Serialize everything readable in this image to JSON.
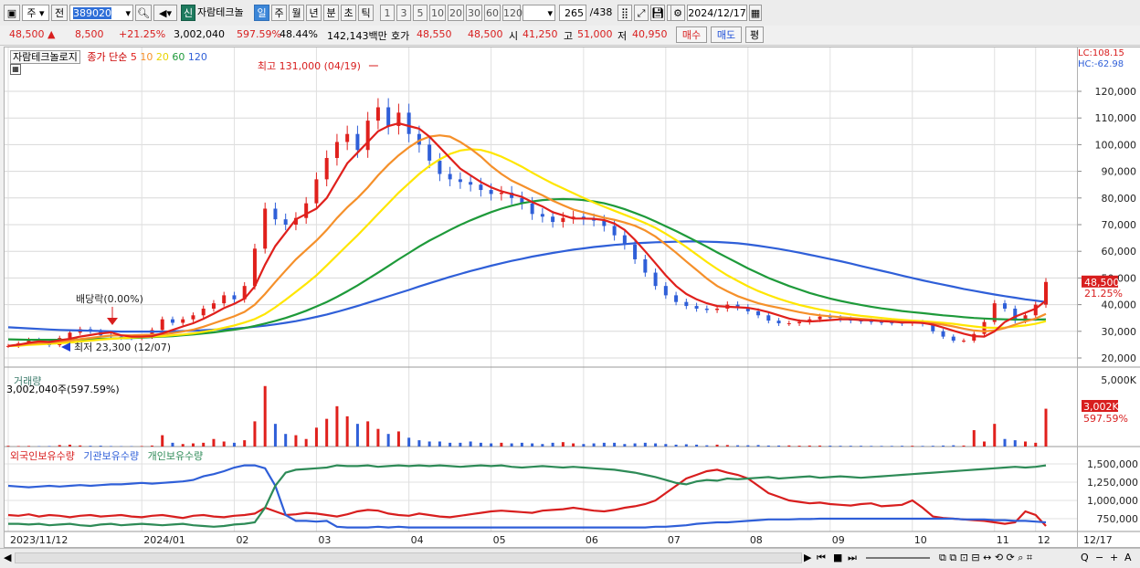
{
  "toolbar": {
    "market": "주",
    "prev_label": "전",
    "code": "389020",
    "new_badge": "신",
    "stock_name": "자람테크놀",
    "periods": [
      "일",
      "주",
      "월",
      "년",
      "분",
      "초",
      "틱"
    ],
    "active_period": "일",
    "intervals": [
      "1",
      "3",
      "5",
      "10",
      "20",
      "30",
      "60",
      "120"
    ],
    "count": "265",
    "total": "/438",
    "date": "2024/12/17"
  },
  "quote": {
    "price": "48,500 ▲",
    "change": "8,500",
    "change_pct": "+21.25%",
    "volume": "3,002,040",
    "volume_ratio": "597.59%",
    "turnover": "48.44%",
    "amount": "142,143백만",
    "bid_label": "호가",
    "ask": "48,550",
    "bid": "48,500",
    "open_label": "시",
    "open": "41,250",
    "high_label": "고",
    "high": "51,000",
    "low_label": "저",
    "low": "40,950",
    "buy_label": "매수",
    "sell_label": "매도",
    "avg_label": "평"
  },
  "chart_data": {
    "type": "candlestick",
    "title": "자람테크놀로지",
    "legend": {
      "ma_label": "종가 단순",
      "periods": [
        "5",
        "10",
        "20",
        "60",
        "120"
      ],
      "colors": [
        "#e0201c",
        "#f5902a",
        "#ffe600",
        "#1e9a3a",
        "#2f5fd8"
      ]
    },
    "price_axis": {
      "ticks": [
        "120,000",
        "110,000",
        "100,000",
        "90,000",
        "80,000",
        "70,000",
        "60,000",
        "50,000",
        "40,000",
        "30,000",
        "20,000"
      ],
      "min": 20000,
      "max": 120000
    },
    "lc": "LC:108.15",
    "hc": "HC:-62.98",
    "last_price": "48,500",
    "last_pct": "21.25%",
    "annotation_high": "최고 131,000 (04/19)",
    "annotation_low": "최저 23,300 (12/07)",
    "annotation_dividend": "배당락(0.00%)",
    "x_labels": [
      "2023/11/12",
      "2024/01",
      "02",
      "03",
      "04",
      "05",
      "06",
      "07",
      "08",
      "09",
      "10",
      "11",
      "12"
    ],
    "axis_end_date": "12/17",
    "closes": [
      24500,
      25500,
      26800,
      26000,
      24800,
      27500,
      29500,
      30800,
      30000,
      28500,
      28000,
      27600,
      27500,
      28000,
      30500,
      34500,
      33200,
      34500,
      36000,
      38500,
      40500,
      43500,
      42000,
      47000,
      61000,
      76000,
      72000,
      70000,
      72500,
      78000,
      87000,
      95000,
      101000,
      104000,
      98000,
      109000,
      114000,
      107000,
      112000,
      104000,
      100000,
      94000,
      89000,
      87000,
      86000,
      85000,
      83000,
      81500,
      82000,
      80000,
      78000,
      74000,
      73000,
      71000,
      72500,
      73000,
      72000,
      71500,
      69500,
      66000,
      62500,
      57000,
      52000,
      47000,
      43500,
      41000,
      39500,
      38500,
      38000,
      38500,
      40000,
      39000,
      37500,
      36000,
      34000,
      33000,
      33000,
      33500,
      34500,
      35500,
      35000,
      34500,
      34000,
      33800,
      33500,
      33300,
      33200,
      33000,
      33300,
      32800,
      30000,
      28000,
      26500,
      26500,
      29000,
      33500,
      40500,
      38500,
      34000,
      36000,
      40000,
      48500
    ],
    "ma5": [
      24500,
      25000,
      25700,
      26200,
      26000,
      26600,
      27200,
      28000,
      28600,
      29200,
      29600,
      28500,
      28000,
      28000,
      28200,
      29200,
      30500,
      31800,
      33000,
      34700,
      36600,
      38700,
      40300,
      42300,
      46800,
      55000,
      62000,
      67000,
      72000,
      74000,
      76000,
      80000,
      86500,
      93000,
      97000,
      101000,
      105000,
      107000,
      108000,
      107000,
      106000,
      103000,
      99000,
      95000,
      91000,
      88500,
      86000,
      84000,
      82500,
      81500,
      80400,
      78500,
      76800,
      74700,
      73500,
      72300,
      72300,
      72200,
      71700,
      70400,
      68000,
      64300,
      60000,
      55500,
      51000,
      47000,
      44000,
      42000,
      40500,
      39500,
      39200,
      39000,
      38800,
      38100,
      37200,
      36000,
      34800,
      34000,
      33700,
      33900,
      34200,
      34500,
      34500,
      34200,
      34100,
      33800,
      33600,
      33300,
      33300,
      33100,
      32500,
      31400,
      30200,
      29100,
      28200,
      28000,
      30000,
      33500,
      35500,
      37000,
      38500,
      41500
    ],
    "ma10": [
      24500,
      24800,
      25300,
      25600,
      25800,
      26100,
      26500,
      27100,
      27500,
      28000,
      28400,
      28500,
      28500,
      28600,
      28700,
      28900,
      29300,
      29900,
      30600,
      31700,
      33000,
      34300,
      35600,
      37300,
      40000,
      44000,
      48500,
      52800,
      57000,
      60500,
      64000,
      68000,
      72500,
      76500,
      80000,
      84000,
      88500,
      92500,
      96000,
      99000,
      101500,
      103000,
      103500,
      103000,
      101000,
      98500,
      95500,
      92000,
      89000,
      86500,
      84700,
      82800,
      81000,
      79000,
      77300,
      75700,
      74600,
      73600,
      72600,
      71800,
      70800,
      69600,
      67800,
      65500,
      62600,
      59500,
      56200,
      53000,
      49800,
      47000,
      45000,
      43200,
      41800,
      40500,
      39600,
      38800,
      38000,
      37200,
      36500,
      36000,
      35600,
      35300,
      35000,
      34700,
      34400,
      34100,
      33900,
      33700,
      33500,
      33300,
      33000,
      32500,
      31800,
      31000,
      30300,
      30000,
      30300,
      31200,
      32500,
      33700,
      34800,
      36500
    ],
    "ma20": [
      24500,
      24600,
      24900,
      25100,
      25300,
      25500,
      25800,
      26200,
      26500,
      26900,
      27200,
      27400,
      27600,
      27800,
      28000,
      28200,
      28500,
      28800,
      29200,
      29800,
      30500,
      31300,
      32200,
      33300,
      34600,
      36500,
      39000,
      41800,
      44800,
      47800,
      51000,
      54700,
      58500,
      62300,
      66000,
      70000,
      74000,
      78000,
      82000,
      85500,
      89000,
      92000,
      94500,
      96500,
      97800,
      98300,
      98000,
      97000,
      95500,
      93700,
      91700,
      89500,
      87400,
      85400,
      83600,
      81800,
      80000,
      78300,
      76700,
      75200,
      73700,
      72200,
      70600,
      68800,
      66600,
      64200,
      61600,
      58800,
      56000,
      53400,
      51000,
      48900,
      46900,
      45100,
      43600,
      42200,
      41000,
      39900,
      39000,
      38200,
      37500,
      36900,
      36300,
      35800,
      35400,
      35000,
      34600,
      34300,
      34000,
      33800,
      33500,
      33200,
      32800,
      32300,
      31800,
      31400,
      31300,
      31400,
      31800,
      32200,
      32800,
      33800
    ],
    "ma60": [
      27000,
      26900,
      26800,
      26800,
      26800,
      26800,
      26900,
      27000,
      27100,
      27200,
      27300,
      27400,
      27500,
      27600,
      27800,
      28000,
      28200,
      28500,
      28800,
      29200,
      29600,
      30100,
      30600,
      31200,
      32000,
      32900,
      33900,
      35000,
      36300,
      37700,
      39300,
      41000,
      42900,
      45000,
      47200,
      49600,
      52000,
      54500,
      57000,
      59400,
      61800,
      64000,
      66000,
      68000,
      69900,
      71600,
      73200,
      74700,
      76000,
      77100,
      78000,
      78700,
      79200,
      79500,
      79600,
      79500,
      79200,
      78700,
      78000,
      77000,
      75800,
      74400,
      72900,
      71200,
      69400,
      67600,
      65700,
      63700,
      61700,
      59600,
      57600,
      55600,
      53600,
      51800,
      50000,
      48500,
      47000,
      45700,
      44400,
      43300,
      42300,
      41400,
      40600,
      39900,
      39200,
      38600,
      38100,
      37600,
      37200,
      36800,
      36400,
      36000,
      35700,
      35300,
      35000,
      34800,
      34600,
      34500,
      34400,
      34400,
      34400,
      34500
    ],
    "ma120": [
      31500,
      31300,
      31100,
      30900,
      30700,
      30500,
      30400,
      30300,
      30200,
      30100,
      30000,
      29900,
      29900,
      29900,
      29900,
      29900,
      30000,
      30100,
      30200,
      30400,
      30600,
      30800,
      31000,
      31300,
      31700,
      32100,
      32600,
      33200,
      33800,
      34600,
      35400,
      36300,
      37300,
      38400,
      39500,
      40700,
      41900,
      43100,
      44300,
      45500,
      46800,
      48000,
      49200,
      50400,
      51500,
      52600,
      53600,
      54600,
      55500,
      56400,
      57200,
      58000,
      58700,
      59400,
      60000,
      60600,
      61100,
      61600,
      62000,
      62400,
      62700,
      63000,
      63200,
      63400,
      63500,
      63600,
      63700,
      63700,
      63600,
      63500,
      63300,
      63000,
      62600,
      62100,
      61500,
      60900,
      60200,
      59500,
      58700,
      57900,
      57100,
      56300,
      55400,
      54500,
      53600,
      52700,
      51800,
      50900,
      50000,
      49100,
      48300,
      47500,
      46700,
      45900,
      45200,
      44500,
      43800,
      43200,
      42600,
      42000,
      41500,
      41000
    ],
    "volume_panel": {
      "title": "거래량",
      "current": "3,002,040주(597.59%)",
      "ticks": [
        "5,000K"
      ],
      "last_value": "3,002K",
      "last_pct": "597.59%",
      "values": [
        60,
        40,
        50,
        30,
        40,
        120,
        150,
        90,
        60,
        70,
        40,
        30,
        30,
        40,
        80,
        900,
        300,
        200,
        250,
        300,
        600,
        400,
        300,
        500,
        2000,
        4800,
        1800,
        1000,
        900,
        600,
        1500,
        2200,
        3200,
        2400,
        1800,
        2000,
        1400,
        1000,
        1200,
        700,
        500,
        400,
        400,
        300,
        300,
        400,
        300,
        250,
        300,
        250,
        300,
        250,
        200,
        300,
        350,
        250,
        200,
        250,
        300,
        300,
        200,
        250,
        300,
        250,
        200,
        150,
        180,
        150,
        100,
        150,
        120,
        100,
        100,
        120,
        80,
        80,
        90,
        70,
        80,
        80,
        70,
        60,
        60,
        60,
        50,
        50,
        50,
        60,
        60,
        50,
        60,
        80,
        100,
        80,
        1300,
        400,
        1800,
        600,
        500,
        400,
        300,
        3002
      ]
    },
    "holdings_panel": {
      "legend": [
        "외국인보유수량",
        "기관보유수량",
        "개인보유수량"
      ],
      "colors": [
        "#d81e1e",
        "#2f5fd8",
        "#2e8b57"
      ],
      "ticks": [
        "1,500,000",
        "1,250,000",
        "1,000,000",
        "750,000"
      ],
      "min": 600000,
      "max": 1600000,
      "foreign": [
        800000,
        790000,
        810000,
        780000,
        800000,
        790000,
        770000,
        790000,
        800000,
        780000,
        790000,
        800000,
        780000,
        770000,
        790000,
        800000,
        780000,
        760000,
        790000,
        800000,
        780000,
        770000,
        790000,
        800000,
        820000,
        900000,
        850000,
        800000,
        810000,
        830000,
        820000,
        800000,
        780000,
        810000,
        850000,
        870000,
        860000,
        820000,
        800000,
        790000,
        820000,
        800000,
        780000,
        770000,
        790000,
        810000,
        830000,
        850000,
        860000,
        850000,
        840000,
        830000,
        860000,
        870000,
        880000,
        900000,
        880000,
        860000,
        850000,
        870000,
        900000,
        920000,
        950000,
        1000000,
        1100000,
        1200000,
        1300000,
        1350000,
        1400000,
        1420000,
        1380000,
        1350000,
        1300000,
        1200000,
        1100000,
        1050000,
        1000000,
        980000,
        960000,
        970000,
        950000,
        940000,
        930000,
        950000,
        960000,
        920000,
        930000,
        940000,
        1000000,
        900000,
        780000,
        760000,
        750000,
        740000,
        730000,
        720000,
        700000,
        680000,
        700000,
        850000,
        800000,
        650000
      ],
      "institution": [
        1200000,
        1190000,
        1180000,
        1190000,
        1200000,
        1190000,
        1200000,
        1210000,
        1200000,
        1210000,
        1220000,
        1220000,
        1230000,
        1240000,
        1230000,
        1240000,
        1250000,
        1260000,
        1280000,
        1330000,
        1360000,
        1400000,
        1450000,
        1480000,
        1480000,
        1440000,
        1200000,
        800000,
        720000,
        720000,
        710000,
        720000,
        640000,
        630000,
        630000,
        630000,
        640000,
        630000,
        640000,
        630000,
        630000,
        630000,
        630000,
        630000,
        630000,
        630000,
        630000,
        630000,
        630000,
        630000,
        630000,
        630000,
        630000,
        630000,
        630000,
        630000,
        630000,
        630000,
        630000,
        630000,
        630000,
        630000,
        630000,
        640000,
        640000,
        650000,
        660000,
        680000,
        690000,
        700000,
        700000,
        710000,
        720000,
        730000,
        740000,
        740000,
        740000,
        745000,
        745000,
        750000,
        750000,
        750000,
        750000,
        750000,
        750000,
        750000,
        750000,
        750000,
        750000,
        750000,
        750000,
        750000,
        750000,
        740000,
        740000,
        740000,
        730000,
        730000,
        720000,
        720000,
        710000,
        700000
      ],
      "individual": [
        680000,
        680000,
        670000,
        680000,
        660000,
        670000,
        680000,
        660000,
        650000,
        670000,
        680000,
        660000,
        670000,
        680000,
        670000,
        660000,
        670000,
        680000,
        660000,
        650000,
        640000,
        650000,
        670000,
        680000,
        700000,
        900000,
        1200000,
        1380000,
        1420000,
        1430000,
        1440000,
        1450000,
        1480000,
        1470000,
        1470000,
        1480000,
        1460000,
        1470000,
        1480000,
        1470000,
        1480000,
        1470000,
        1480000,
        1470000,
        1460000,
        1470000,
        1480000,
        1470000,
        1480000,
        1460000,
        1450000,
        1460000,
        1470000,
        1460000,
        1450000,
        1460000,
        1450000,
        1440000,
        1430000,
        1420000,
        1400000,
        1380000,
        1350000,
        1320000,
        1280000,
        1240000,
        1220000,
        1260000,
        1280000,
        1270000,
        1300000,
        1290000,
        1300000,
        1310000,
        1320000,
        1300000,
        1310000,
        1320000,
        1330000,
        1310000,
        1320000,
        1330000,
        1320000,
        1310000,
        1320000,
        1330000,
        1340000,
        1350000,
        1360000,
        1370000,
        1380000,
        1390000,
        1400000,
        1410000,
        1420000,
        1430000,
        1440000,
        1450000,
        1460000,
        1450000,
        1460000,
        1480000
      ]
    }
  },
  "status": {
    "zoom_min": "−",
    "zoom_plus": "+",
    "font": "A",
    "search": "Q"
  }
}
